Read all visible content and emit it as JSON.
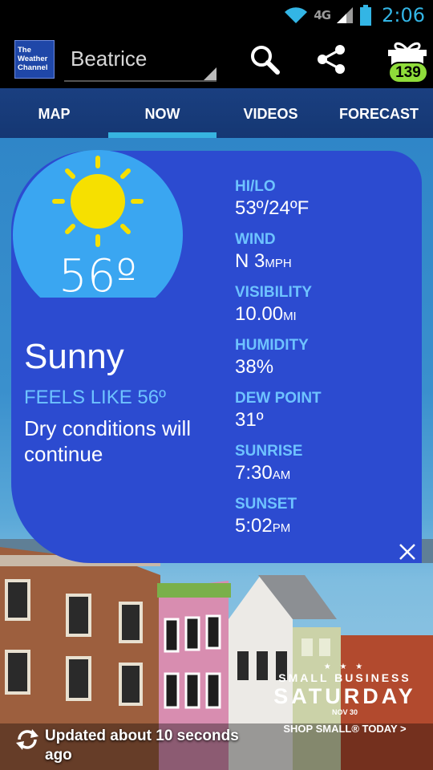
{
  "status_bar": {
    "time": "2:06",
    "network": "4G",
    "icons": [
      "wifi-icon",
      "signal-icon",
      "battery-icon"
    ]
  },
  "app_bar": {
    "logo_text": "The Weather Channel",
    "location": "Beatrice",
    "actions": [
      "search-icon",
      "share-icon",
      "gift-icon"
    ],
    "gift_badge": "139"
  },
  "tabs": [
    {
      "label": "MAP",
      "active": false
    },
    {
      "label": "NOW",
      "active": true
    },
    {
      "label": "VIDEOS",
      "active": false
    },
    {
      "label": "FORECAST",
      "active": false
    }
  ],
  "current": {
    "temp": "56º",
    "condition": "Sunny",
    "feels_like": "FEELS LIKE 56º",
    "description": "Dry conditions will continue",
    "icon": "sun-icon"
  },
  "stats": {
    "hilo": {
      "label": "HI/LO",
      "value": "53º/24ºF"
    },
    "wind": {
      "label": "WIND",
      "value": "N 3",
      "unit": "MPH"
    },
    "visibility": {
      "label": "VISIBILITY",
      "value": "10.00",
      "unit": "MI"
    },
    "humidity": {
      "label": "HUMIDITY",
      "value": "38%"
    },
    "dew_point": {
      "label": "DEW POINT",
      "value": "31º"
    },
    "sunrise": {
      "label": "SUNRISE",
      "value": "7:30",
      "unit": "AM"
    },
    "sunset": {
      "label": "SUNSET",
      "value": "5:02",
      "unit": "PM"
    }
  },
  "footer": {
    "updated": "Updated about 10 seconds ago"
  },
  "ad": {
    "stars": "★ ★ ★",
    "line1": "SMALL BUSINESS",
    "line2": "SATURDAY",
    "date": "NOV 30",
    "cta": "SHOP SMALL® TODAY >"
  },
  "colors": {
    "card": "#2c4bd0",
    "accent": "#37b4e0",
    "label": "#6ec3ff",
    "sun": "#f6e000",
    "sun_bg": "#3aa6f1"
  }
}
